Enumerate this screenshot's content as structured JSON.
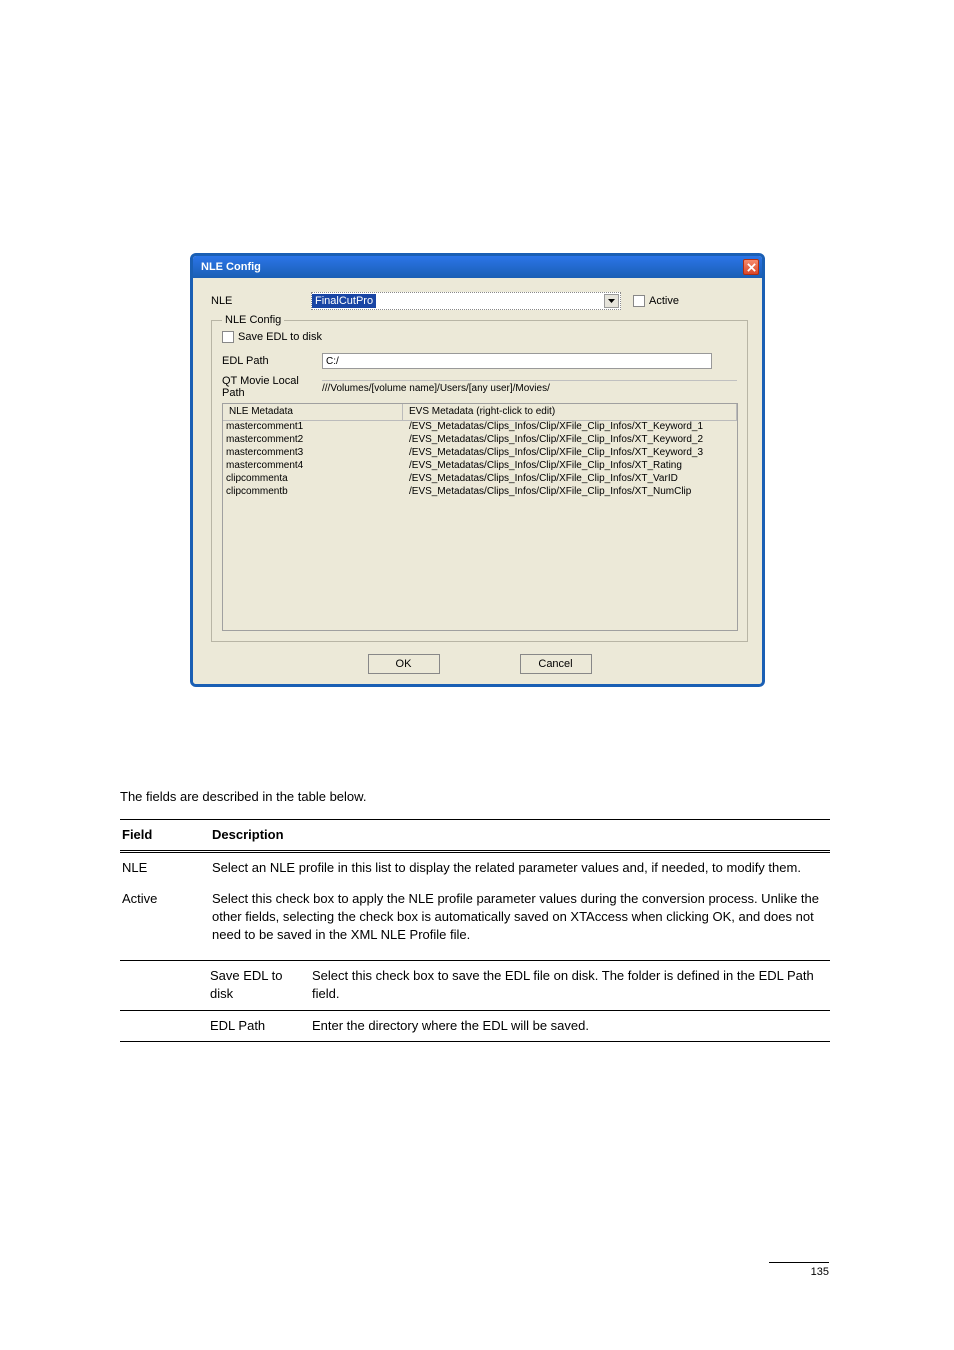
{
  "dialog": {
    "title": "NLE Config",
    "nle_label": "NLE",
    "nle_value": "FinalCutPro",
    "active_label": "Active",
    "fieldset_legend": "NLE Config",
    "save_edl_label": "Save EDL to disk",
    "edl_path_label": "EDL Path",
    "edl_path_value": "C:/",
    "qt_path_label": "QT Movie Local Path",
    "qt_path_value": "///Volumes/[volume name]/Users/[any user]/Movies/",
    "meta_header": {
      "col1": "NLE Metadata",
      "col2": "EVS Metadata     (right-click to edit)"
    },
    "meta_rows": [
      {
        "nle": "mastercomment1",
        "evs": "/EVS_Metadatas/Clips_Infos/Clip/XFile_Clip_Infos/XT_Keyword_1"
      },
      {
        "nle": "mastercomment2",
        "evs": "/EVS_Metadatas/Clips_Infos/Clip/XFile_Clip_Infos/XT_Keyword_2"
      },
      {
        "nle": "mastercomment3",
        "evs": "/EVS_Metadatas/Clips_Infos/Clip/XFile_Clip_Infos/XT_Keyword_3"
      },
      {
        "nle": "mastercomment4",
        "evs": "/EVS_Metadatas/Clips_Infos/Clip/XFile_Clip_Infos/XT_Rating"
      },
      {
        "nle": "clipcommenta",
        "evs": "/EVS_Metadatas/Clips_Infos/Clip/XFile_Clip_Infos/XT_VarID"
      },
      {
        "nle": "clipcommentb",
        "evs": "/EVS_Metadatas/Clips_Infos/Clip/XFile_Clip_Infos/XT_NumClip"
      }
    ],
    "ok_label": "OK",
    "cancel_label": "Cancel"
  },
  "doc": {
    "intro": "The fields are described in the table below.",
    "table_head": {
      "col1": "Field",
      "col2": "Description"
    },
    "rows": [
      {
        "f": "NLE",
        "d": "Select an NLE profile in this list to display the related parameter values and, if needed, to modify them."
      },
      {
        "f": "Active",
        "d": "Select this check box to apply the NLE profile parameter values during the conversion process. Unlike the other fields, selecting the check box is automatically saved on XTAccess when clicking OK, and does not need to be saved in the XML NLE Profile file."
      }
    ],
    "save_label": "Save EDL to disk",
    "save_desc": "Select this check box to save the EDL file on disk. The folder is defined in the EDL Path field.",
    "edl_label": "EDL Path",
    "edl_desc": "Enter the directory where the EDL will be saved.",
    "pagenum": "135"
  }
}
